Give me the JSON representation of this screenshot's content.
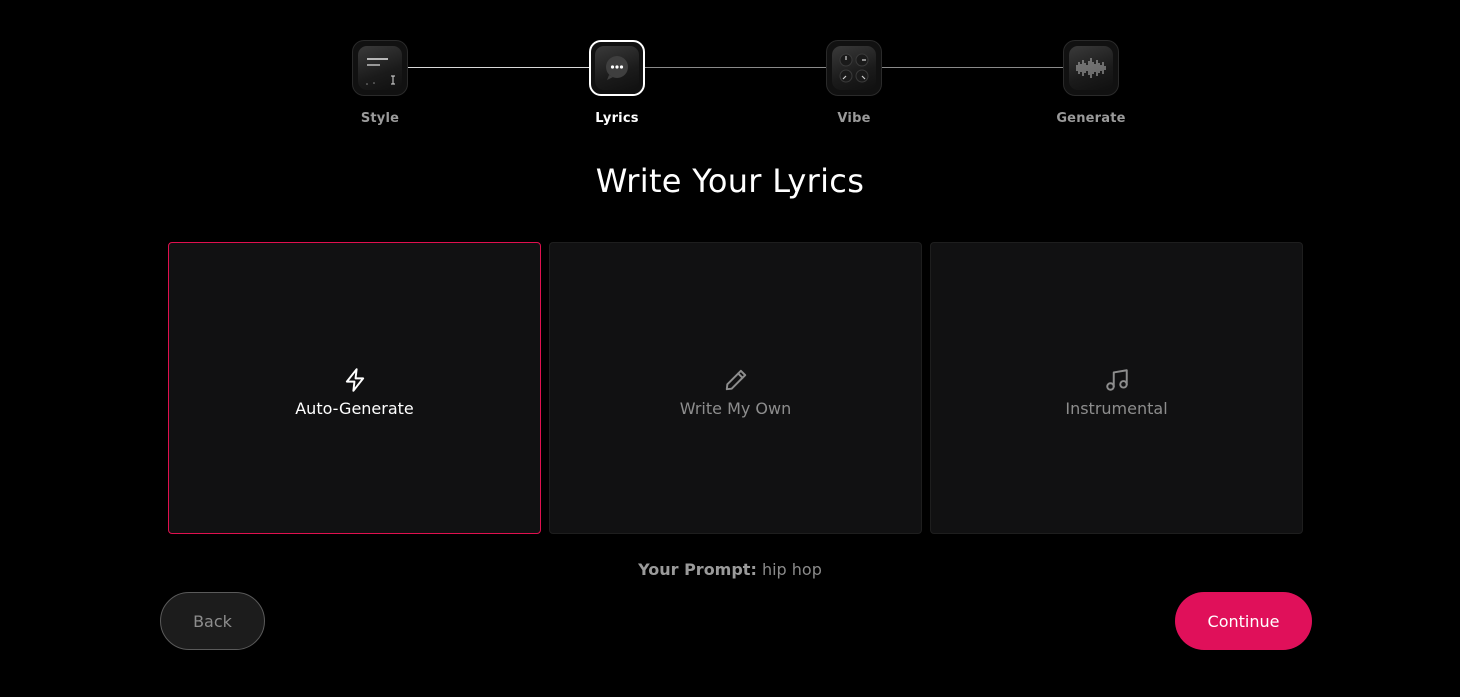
{
  "stepper": {
    "steps": [
      {
        "label": "Style",
        "icon": "text-lines-icon",
        "active": false
      },
      {
        "label": "Lyrics",
        "icon": "chat-bubble-icon",
        "active": true
      },
      {
        "label": "Vibe",
        "icon": "knobs-icon",
        "active": false
      },
      {
        "label": "Generate",
        "icon": "waveform-icon",
        "active": false
      }
    ]
  },
  "title": "Write Your Lyrics",
  "options": [
    {
      "label": "Auto-Generate",
      "icon": "lightning-icon",
      "selected": true
    },
    {
      "label": "Write My Own",
      "icon": "pencil-icon",
      "selected": false
    },
    {
      "label": "Instrumental",
      "icon": "music-note-icon",
      "selected": false
    }
  ],
  "prompt": {
    "label": "Your Prompt:",
    "value": "hip hop"
  },
  "buttons": {
    "back": "Back",
    "continue": "Continue"
  },
  "colors": {
    "accent": "#e0105a",
    "background": "#000000",
    "card": "#111112"
  }
}
